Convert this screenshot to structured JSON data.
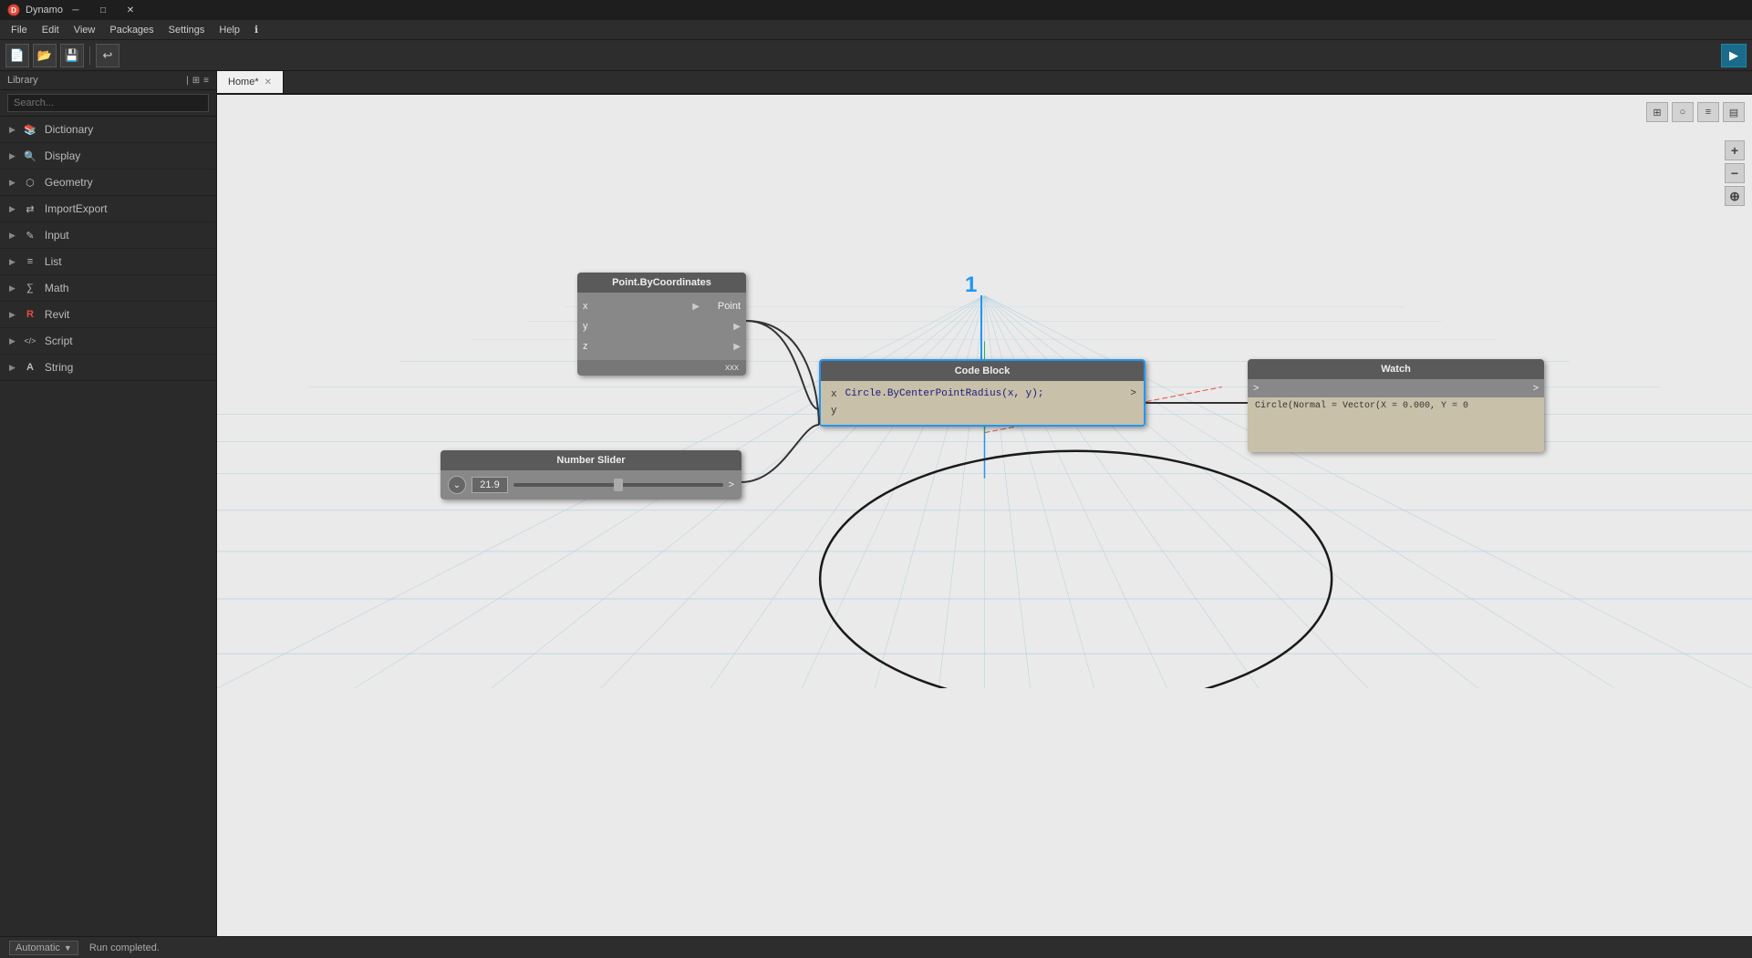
{
  "app": {
    "title": "Dynamo",
    "tab_name": "Home*"
  },
  "menu": {
    "items": [
      "File",
      "Edit",
      "View",
      "Packages",
      "Settings",
      "Help",
      "ℹ"
    ]
  },
  "library": {
    "title": "Library",
    "search_placeholder": "Search...",
    "items": [
      {
        "label": "Dictionary",
        "icon": "📚",
        "type": "book"
      },
      {
        "label": "Display",
        "icon": "🔍",
        "type": "search"
      },
      {
        "label": "Geometry",
        "icon": "⬡",
        "type": "shape"
      },
      {
        "label": "ImportExport",
        "icon": "⇄",
        "type": "arrows"
      },
      {
        "label": "Input",
        "icon": "✎",
        "type": "pencil"
      },
      {
        "label": "List",
        "icon": "≡",
        "type": "list"
      },
      {
        "label": "Math",
        "icon": "∑",
        "type": "sigma"
      },
      {
        "label": "Revit",
        "icon": "R",
        "type": "revit"
      },
      {
        "label": "Script",
        "icon": "</>",
        "type": "code"
      },
      {
        "label": "String",
        "icon": "A",
        "type": "text"
      }
    ]
  },
  "nodes": {
    "point_by_coordinates": {
      "title": "Point.ByCoordinates",
      "inputs": [
        "x",
        "y",
        "z"
      ],
      "output": "Point",
      "footer": "xxx"
    },
    "code_block": {
      "title": "Code Block",
      "code": "Circle.ByCenterPointRadius(x, y);",
      "port_x": "x",
      "port_y": "y",
      "port_out": ">"
    },
    "watch": {
      "title": "Watch",
      "port_in": ">",
      "port_out": ">",
      "output_text": "Circle(Normal = Vector(X = 0.000, Y = 0"
    },
    "number_slider": {
      "title": "Number Slider",
      "value": "21.9",
      "port_out": ">"
    }
  },
  "number_label": "1",
  "statusbar": {
    "run_mode": "Automatic",
    "run_status": "Run completed."
  },
  "canvas_controls": {
    "btn1": "⊞",
    "btn2": "○",
    "btn3": "≡",
    "btn4": "▤",
    "zoom_in": "+",
    "zoom_out": "−",
    "zoom_fit": "⊕"
  }
}
